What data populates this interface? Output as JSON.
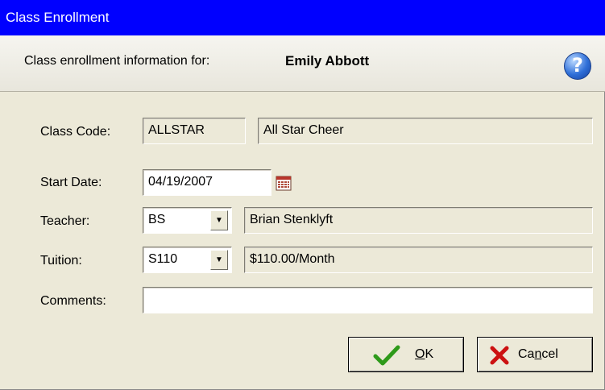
{
  "window": {
    "title": "Class Enrollment"
  },
  "header": {
    "prompt": "Class enrollment information for:",
    "student_name": "Emily Abbott",
    "help_glyph": "?"
  },
  "form": {
    "class_code": {
      "label": "Class Code:",
      "code": "ALLSTAR",
      "name": "All Star Cheer"
    },
    "start_date": {
      "label": "Start Date:",
      "value": "04/19/2007"
    },
    "teacher": {
      "label": "Teacher:",
      "code": "BS",
      "name": "Brian Stenklyft"
    },
    "tuition": {
      "label": "Tuition:",
      "code": "S110",
      "description": "$110.00/Month"
    },
    "comments": {
      "label": "Comments:",
      "value": ""
    }
  },
  "buttons": {
    "ok": {
      "label_prefix": "",
      "mnemonic": "O",
      "label_rest": "K"
    },
    "cancel": {
      "label_prefix": "Ca",
      "mnemonic": "n",
      "label_rest": "cel"
    }
  },
  "icons": {
    "help": "help-icon",
    "calendar": "calendar-icon",
    "dropdown": "chevron-down-icon",
    "ok": "checkmark-icon",
    "cancel": "x-icon"
  },
  "colors": {
    "titlebar": "#0000ff",
    "background": "#ece9d8",
    "ok_check": "#2e9a1a",
    "cancel_x": "#cc1111"
  }
}
